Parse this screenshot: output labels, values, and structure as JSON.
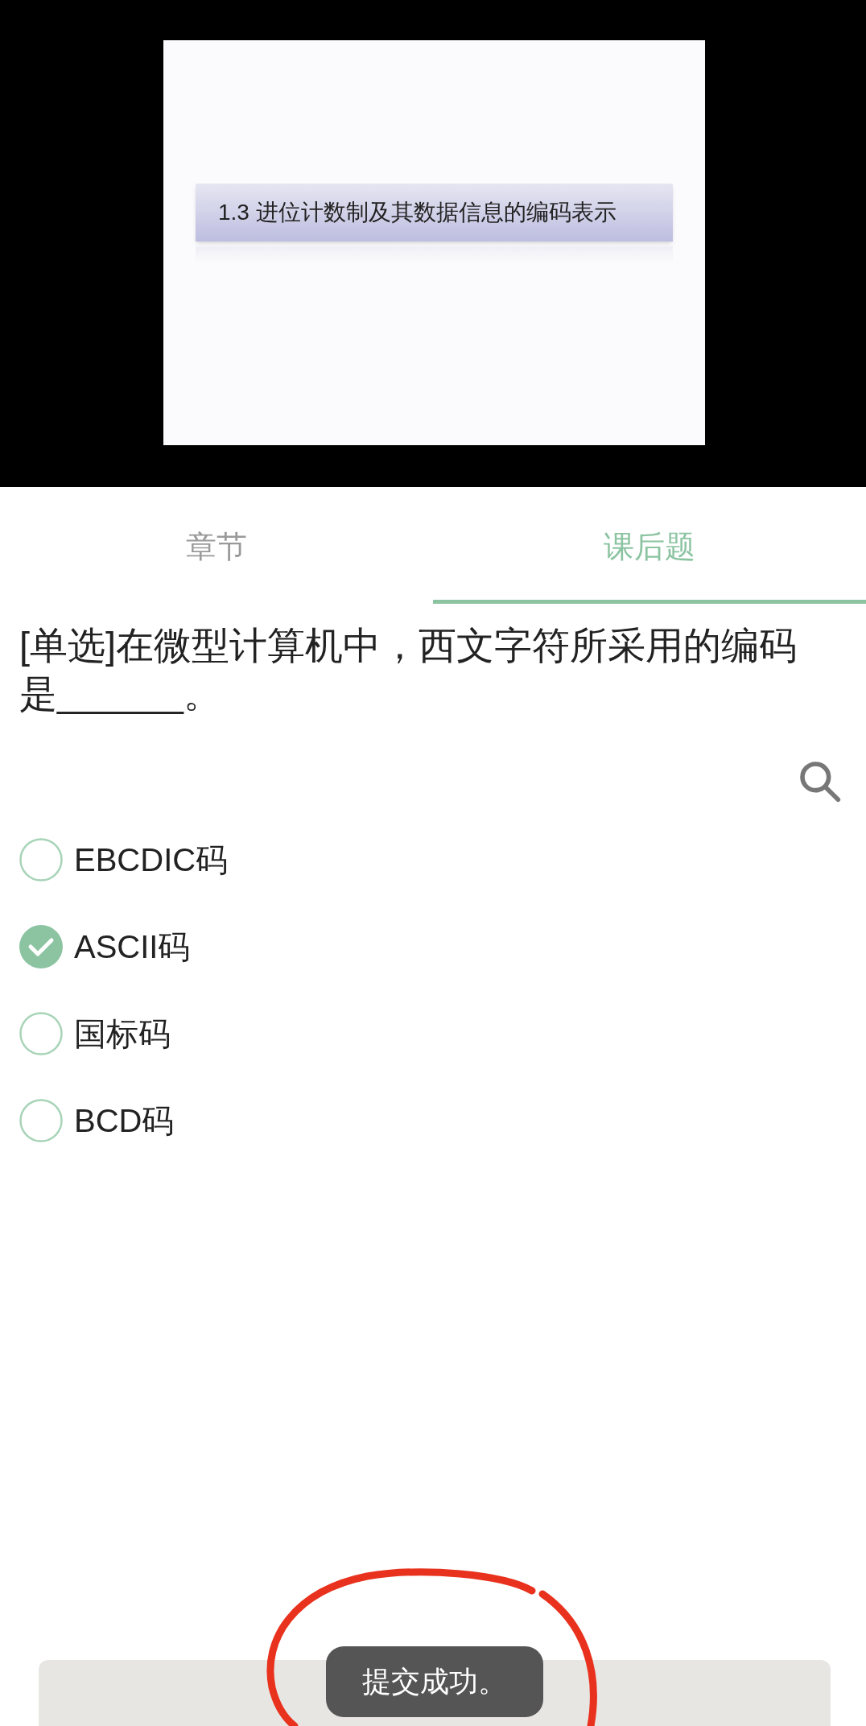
{
  "video": {
    "slide_title": "1.3  进位计数制及其数据信息的编码表示"
  },
  "tabs": [
    {
      "label": "章节",
      "selected": false
    },
    {
      "label": "课后题",
      "selected": true
    }
  ],
  "question": {
    "text": "[单选]在微型计算机中，西文字符所采用的编码是______。"
  },
  "options": [
    {
      "label": "EBCDIC码",
      "selected": false
    },
    {
      "label": "ASCII码",
      "selected": true
    },
    {
      "label": "国标码",
      "selected": false
    },
    {
      "label": "BCD码",
      "selected": false
    }
  ],
  "toast": "提交成功。"
}
